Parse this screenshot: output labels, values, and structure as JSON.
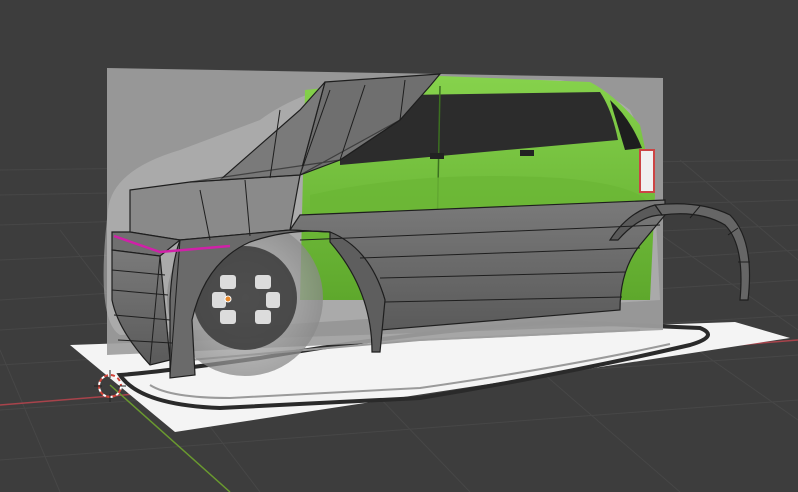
{
  "viewport": {
    "mode": "3d-modeling-viewport",
    "background_color": "#3d3d3d",
    "grid_color": "#4a4a4a",
    "x_axis_color": "#a8434b",
    "y_axis_color": "#6a9a2f",
    "reference_image": "green-hatchback-side-view",
    "car_body_color": "#74c33c",
    "mesh_color": "#6b6b6b",
    "edge_color": "#1e1e1e",
    "selected_edge_color": "#d021a8",
    "ground_plane_color": "#f2f2f2",
    "cursor": "3d-cursor-icon"
  }
}
